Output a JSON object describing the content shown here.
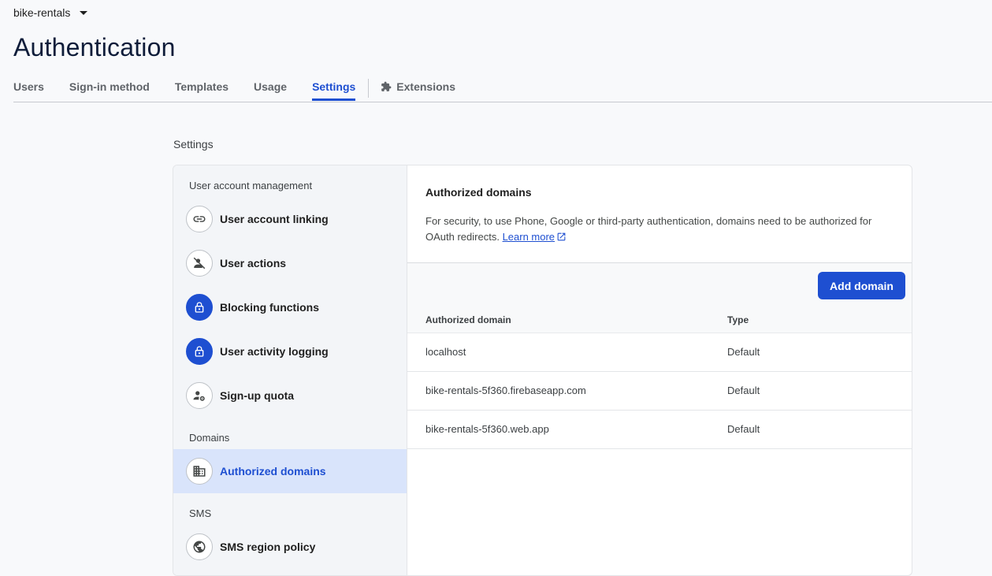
{
  "project": {
    "name": "bike-rentals"
  },
  "page": {
    "title": "Authentication"
  },
  "tabs": [
    {
      "label": "Users"
    },
    {
      "label": "Sign-in method"
    },
    {
      "label": "Templates"
    },
    {
      "label": "Usage"
    },
    {
      "label": "Settings",
      "active": true
    },
    {
      "label": "Extensions"
    }
  ],
  "settings_label": "Settings",
  "sidebar": {
    "groups": [
      {
        "label": "User account management"
      },
      {
        "label": "Domains"
      },
      {
        "label": "SMS"
      }
    ],
    "items": [
      {
        "label": "User account linking",
        "icon": "link-icon"
      },
      {
        "label": "User actions",
        "icon": "person-off-icon"
      },
      {
        "label": "Blocking functions",
        "icon": "lock-icon"
      },
      {
        "label": "User activity logging",
        "icon": "lock-icon"
      },
      {
        "label": "Sign-up quota",
        "icon": "person-gear-icon"
      },
      {
        "label": "Authorized domains",
        "icon": "building-icon",
        "active": true
      },
      {
        "label": "SMS region policy",
        "icon": "globe-icon"
      }
    ]
  },
  "main": {
    "title": "Authorized domains",
    "description": "For security, to use Phone, Google or third-party authentication, domains need to be authorized for OAuth redirects.",
    "learn_more": "Learn more",
    "add_button": "Add domain",
    "columns": [
      "Authorized domain",
      "Type"
    ],
    "rows": [
      {
        "domain": "localhost",
        "type": "Default"
      },
      {
        "domain": "bike-rentals-5f360.firebaseapp.com",
        "type": "Default"
      },
      {
        "domain": "bike-rentals-5f360.web.app",
        "type": "Default"
      }
    ]
  },
  "colors": {
    "accent": "#1e4fd1",
    "active_bg": "#d9e4fb"
  }
}
